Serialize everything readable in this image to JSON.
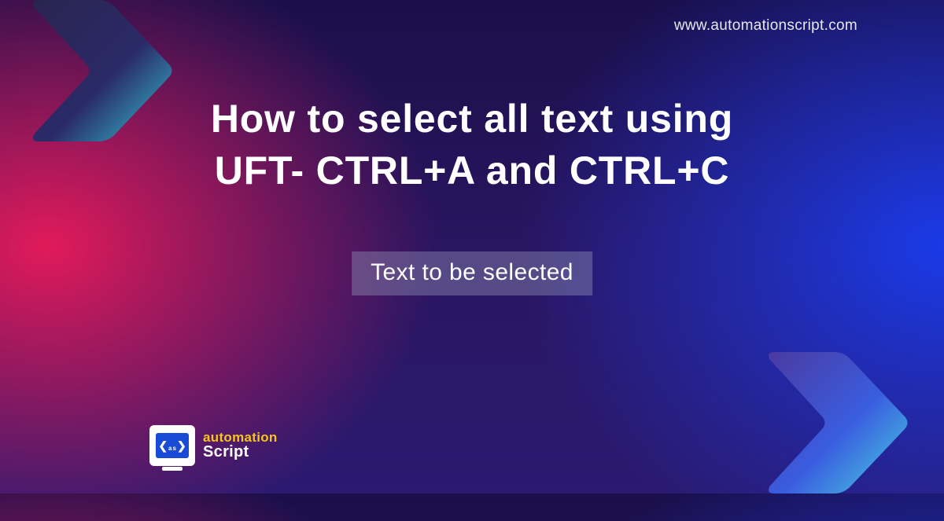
{
  "header": {
    "website_url": "www.automationscript.com"
  },
  "main": {
    "headline_line1": "How to select all text using",
    "headline_line2": "UFT- CTRL+A and CTRL+C",
    "selected_text": "Text to be selected"
  },
  "logo": {
    "word1": "automation",
    "word2": "Script",
    "badge_left": "a",
    "badge_right": "s"
  },
  "decor": {
    "chevron_icon": "chevron-right-icon"
  }
}
